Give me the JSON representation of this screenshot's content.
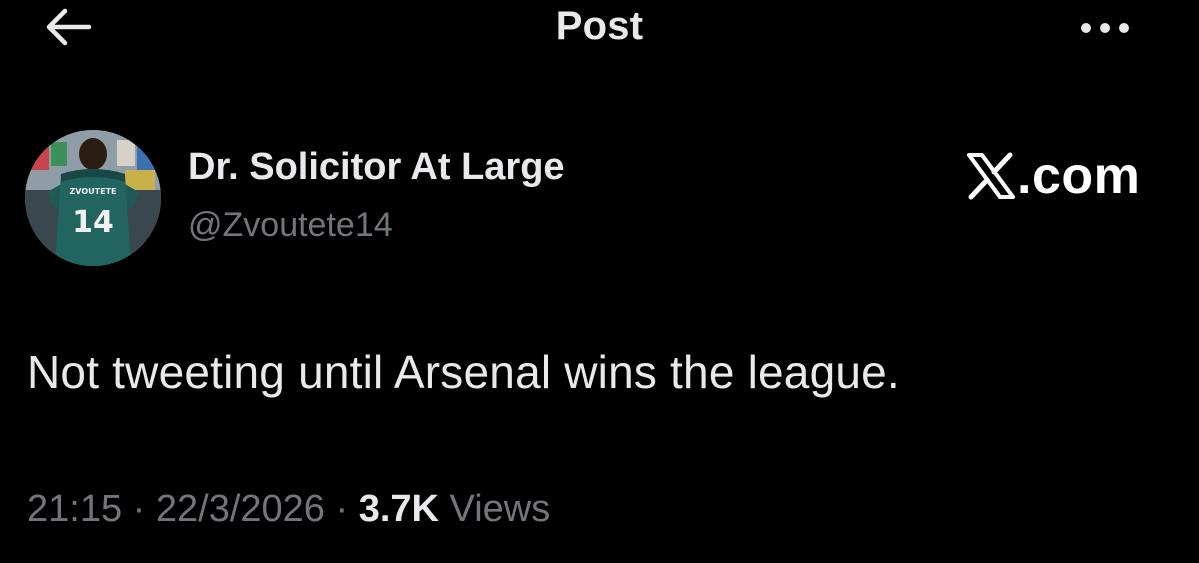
{
  "header": {
    "title": "Post",
    "back_icon": "arrow-left-icon",
    "more_icon": "more-horizontal-icon"
  },
  "author": {
    "display_name": "Dr. Solicitor At Large",
    "handle": "@Zvoutete14",
    "avatar": {
      "jersey_name": "ZVOUTETE",
      "jersey_number": "14"
    }
  },
  "watermark": {
    "text": ".com",
    "icon": "x-logo-icon"
  },
  "tweet": {
    "text": "Not tweeting until Arsenal wins the league."
  },
  "meta": {
    "time": "21:15",
    "separator": " · ",
    "date": "22/3/2026",
    "views_count": "3.7K",
    "views_label": " Views"
  },
  "colors": {
    "background": "#000000",
    "primary_text": "#e7e9ea",
    "secondary_text": "#71767b"
  }
}
